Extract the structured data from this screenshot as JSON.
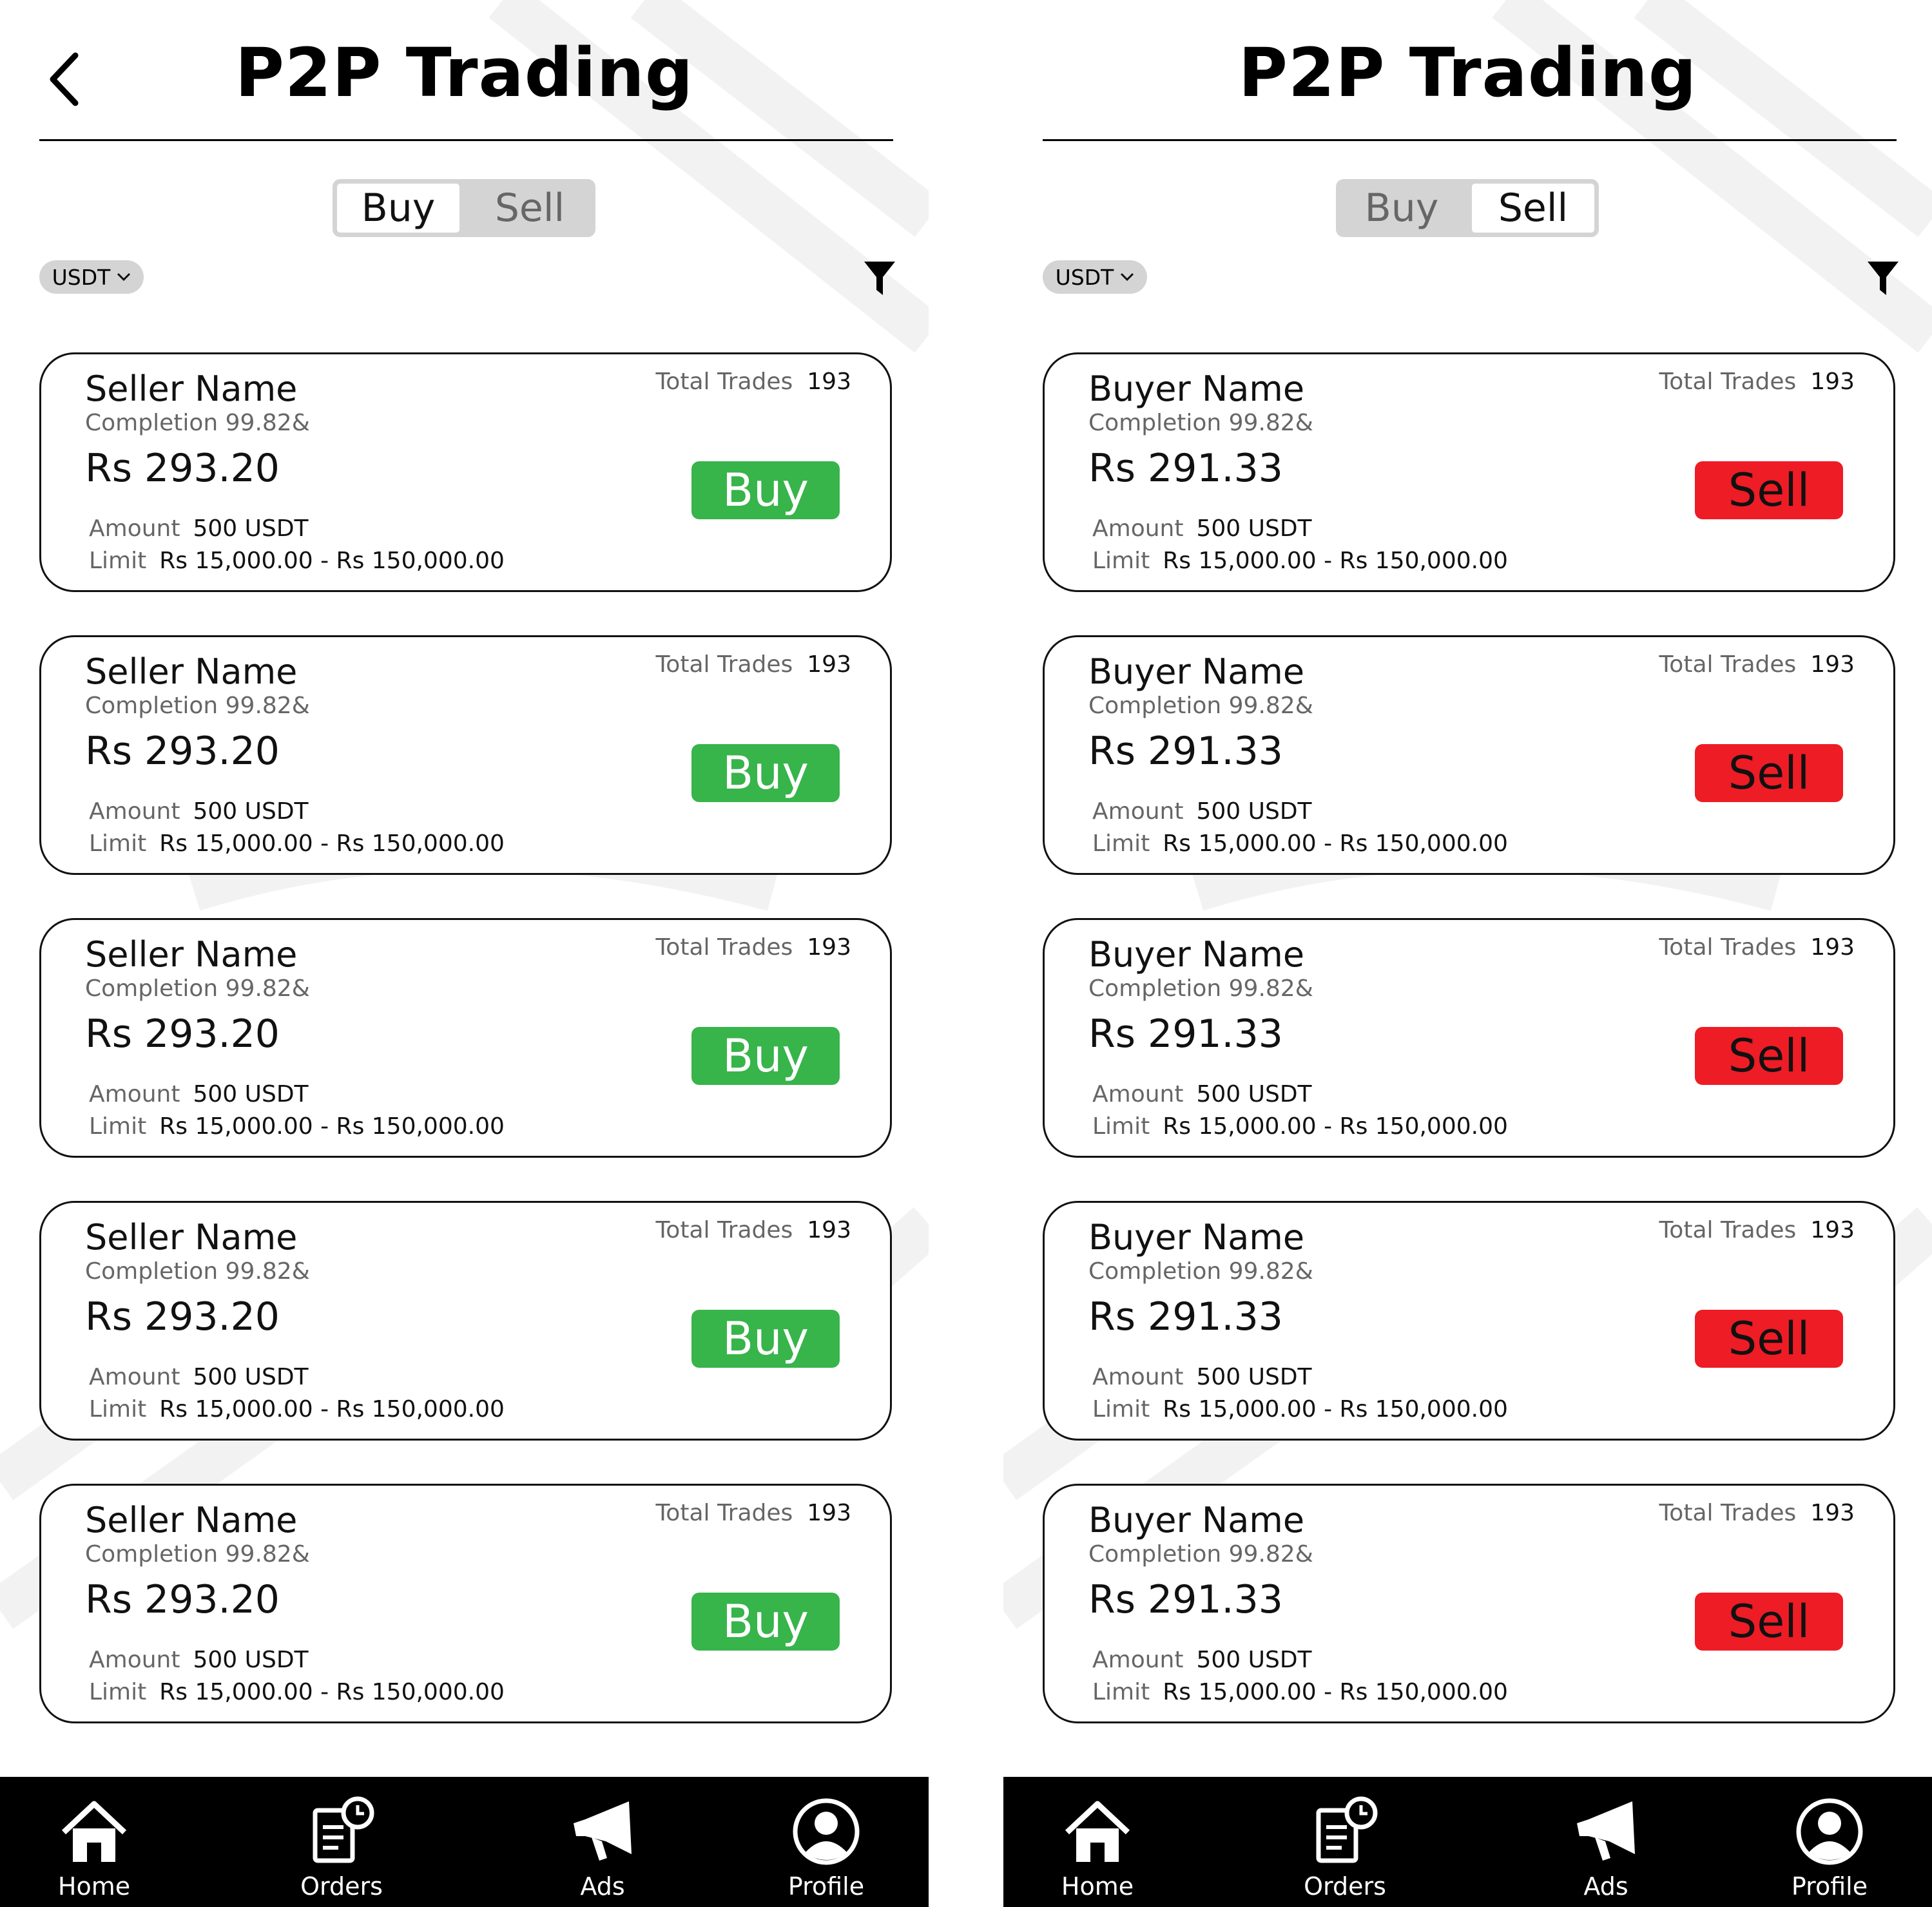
{
  "screens": [
    {
      "title": "P2P Trading",
      "toggle": {
        "buy_label": "Buy",
        "sell_label": "Sell",
        "active": "buy"
      },
      "currency": "USDT",
      "cards": [
        {
          "name": "Seller Name",
          "completion": "Completion 99.82&",
          "price": "Rs 293.20",
          "trades_label": "Total Trades",
          "trades": "193",
          "amount_label": "Amount",
          "amount": "500 USDT",
          "limit_label": "Limit",
          "limit": "Rs 15,000.00 - Rs 150,000.00",
          "action": "Buy"
        },
        {
          "name": "Seller Name",
          "completion": "Completion 99.82&",
          "price": "Rs 293.20",
          "trades_label": "Total Trades",
          "trades": "193",
          "amount_label": "Amount",
          "amount": "500 USDT",
          "limit_label": "Limit",
          "limit": "Rs 15,000.00 - Rs 150,000.00",
          "action": "Buy"
        },
        {
          "name": "Seller Name",
          "completion": "Completion 99.82&",
          "price": "Rs 293.20",
          "trades_label": "Total Trades",
          "trades": "193",
          "amount_label": "Amount",
          "amount": "500 USDT",
          "limit_label": "Limit",
          "limit": "Rs 15,000.00 - Rs 150,000.00",
          "action": "Buy"
        },
        {
          "name": "Seller Name",
          "completion": "Completion 99.82&",
          "price": "Rs 293.20",
          "trades_label": "Total Trades",
          "trades": "193",
          "amount_label": "Amount",
          "amount": "500 USDT",
          "limit_label": "Limit",
          "limit": "Rs 15,000.00 - Rs 150,000.00",
          "action": "Buy"
        },
        {
          "name": "Seller Name",
          "completion": "Completion 99.82&",
          "price": "Rs 293.20",
          "trades_label": "Total Trades",
          "trades": "193",
          "amount_label": "Amount",
          "amount": "500 USDT",
          "limit_label": "Limit",
          "limit": "Rs 15,000.00 - Rs 150,000.00",
          "action": "Buy"
        }
      ]
    },
    {
      "title": "P2P Trading",
      "toggle": {
        "buy_label": "Buy",
        "sell_label": "Sell",
        "active": "sell"
      },
      "currency": "USDT",
      "cards": [
        {
          "name": "Buyer Name",
          "completion": "Completion 99.82&",
          "price": "Rs 291.33",
          "trades_label": "Total Trades",
          "trades": "193",
          "amount_label": "Amount",
          "amount": "500 USDT",
          "limit_label": "Limit",
          "limit": "Rs 15,000.00 - Rs 150,000.00",
          "action": "Sell"
        },
        {
          "name": "Buyer Name",
          "completion": "Completion 99.82&",
          "price": "Rs 291.33",
          "trades_label": "Total Trades",
          "trades": "193",
          "amount_label": "Amount",
          "amount": "500 USDT",
          "limit_label": "Limit",
          "limit": "Rs 15,000.00 - Rs 150,000.00",
          "action": "Sell"
        },
        {
          "name": "Buyer Name",
          "completion": "Completion 99.82&",
          "price": "Rs 291.33",
          "trades_label": "Total Trades",
          "trades": "193",
          "amount_label": "Amount",
          "amount": "500 USDT",
          "limit_label": "Limit",
          "limit": "Rs 15,000.00 - Rs 150,000.00",
          "action": "Sell"
        },
        {
          "name": "Buyer Name",
          "completion": "Completion 99.82&",
          "price": "Rs 291.33",
          "trades_label": "Total Trades",
          "trades": "193",
          "amount_label": "Amount",
          "amount": "500 USDT",
          "limit_label": "Limit",
          "limit": "Rs 15,000.00 - Rs 150,000.00",
          "action": "Sell"
        },
        {
          "name": "Buyer Name",
          "completion": "Completion 99.82&",
          "price": "Rs 291.33",
          "trades_label": "Total Trades",
          "trades": "193",
          "amount_label": "Amount",
          "amount": "500 USDT",
          "limit_label": "Limit",
          "limit": "Rs 15,000.00 - Rs 150,000.00",
          "action": "Sell"
        }
      ]
    }
  ],
  "nav": [
    {
      "label": "Home",
      "icon": "home-icon"
    },
    {
      "label": "Orders",
      "icon": "orders-icon"
    },
    {
      "label": "Ads",
      "icon": "megaphone-icon"
    },
    {
      "label": "Profile",
      "icon": "profile-icon"
    }
  ],
  "colors": {
    "buy": "#37b44a",
    "sell": "#ee1c25",
    "nav_bg": "#000000",
    "toggle_bg": "#d4d4d4"
  }
}
